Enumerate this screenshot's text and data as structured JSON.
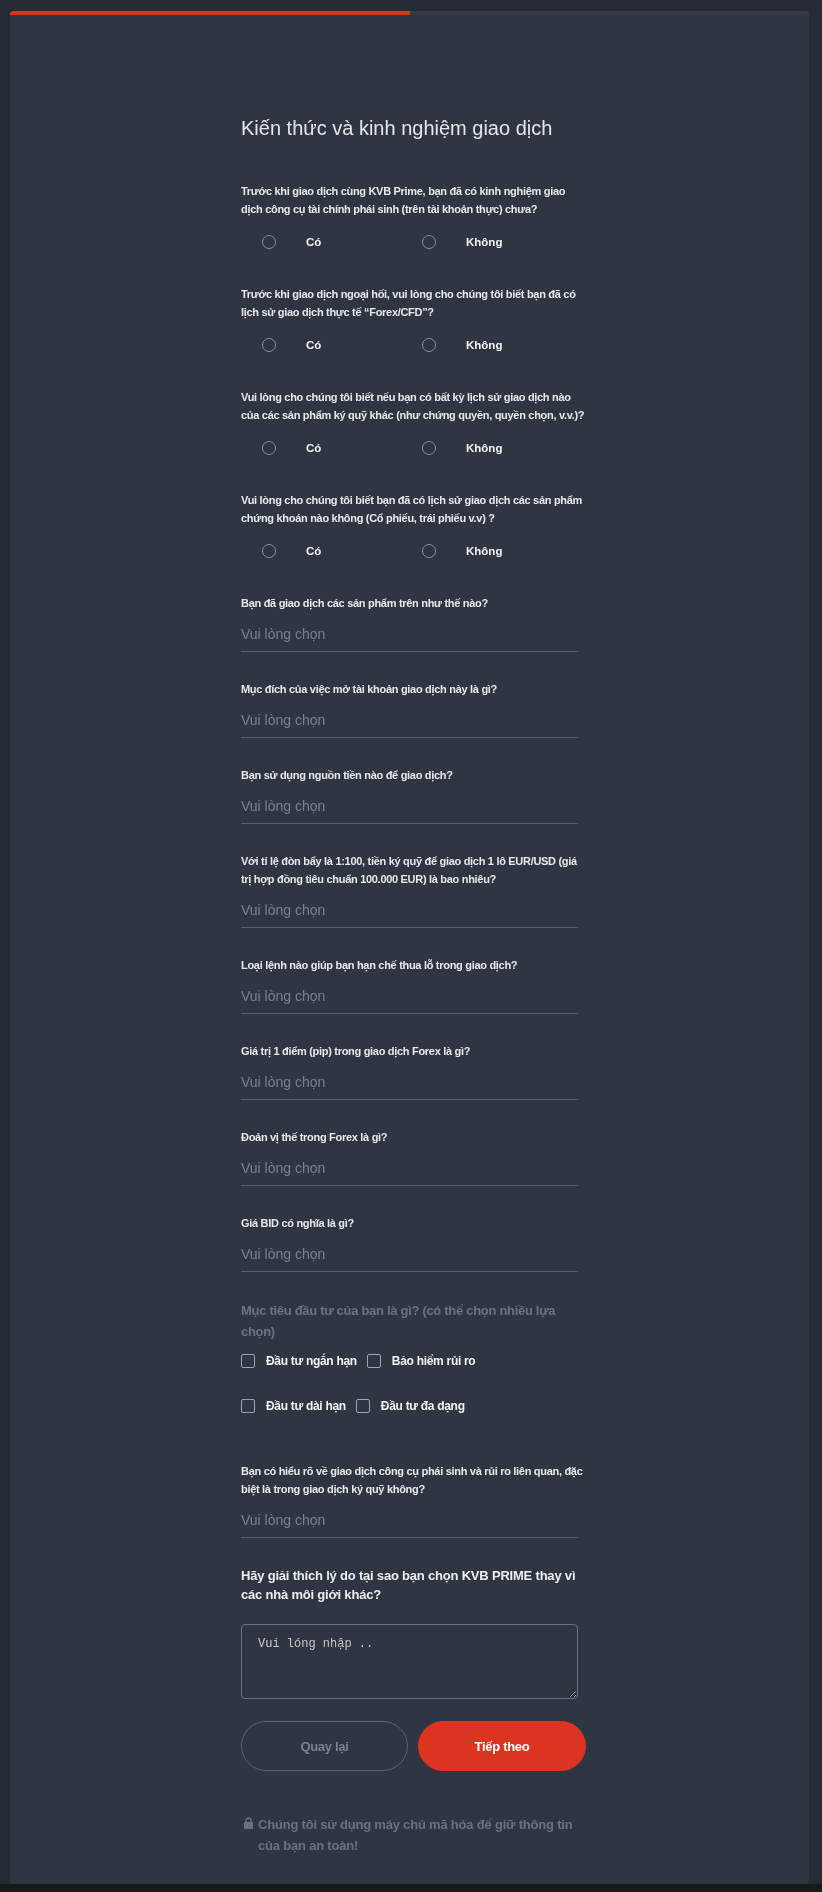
{
  "progress": {
    "level": 0.5
  },
  "title": "Kiến thức và kinh nghiệm giao dịch",
  "questions": [
    {
      "kind": "radio",
      "label": "Trước khi giao dịch cùng KVB Prime, bạn đã có kinh nghiệm giao dịch công cụ tài chính phái sinh (trên tài khoản thực) chưa?",
      "options": [
        {
          "label": "Có",
          "selected": false
        },
        {
          "label": "Không",
          "selected": false
        }
      ]
    },
    {
      "kind": "radio",
      "label": "Trước khi giao dịch ngoại hối, vui lòng cho chúng tôi biết bạn đã có lịch sử giao dịch thực tế “Forex/CFD”?",
      "options": [
        {
          "label": "Có",
          "selected": false
        },
        {
          "label": "Không",
          "selected": false
        }
      ]
    },
    {
      "kind": "radio",
      "label": "Vui lòng cho chúng tôi biết nếu bạn có bất kỳ lịch sử giao dịch nào của các sản phẩm ký quỹ khác (như chứng quyền, quyền chọn, v.v.)?",
      "options": [
        {
          "label": "Có",
          "selected": false
        },
        {
          "label": "Không",
          "selected": false
        }
      ]
    },
    {
      "kind": "radio",
      "label": "Vui lòng cho chúng tôi biết bạn đã có lịch sử giao dịch các sản phẩm chứng khoán nào không (Cổ phiếu, trái phiếu v.v) ?",
      "options": [
        {
          "label": "Có",
          "selected": false
        },
        {
          "label": "Không",
          "selected": false
        }
      ]
    },
    {
      "kind": "select",
      "label": "Bạn đã giao dịch các sản phẩm trên như thế nào?",
      "placeholder": "Vui lòng chọn"
    },
    {
      "kind": "select",
      "label": "Mục đích của việc mở tài khoản giao dịch này là gì?",
      "placeholder": "Vui lòng chọn"
    },
    {
      "kind": "select",
      "label": "Bạn sử dụng nguồn tiền nào để giao dịch?",
      "placeholder": "Vui lòng chọn"
    },
    {
      "kind": "select",
      "label": "Với tỉ lệ đòn bẩy là 1:100, tiền ký quỹ để giao dịch 1 lô EUR/USD (giá trị hợp đồng tiêu chuẩn 100.000 EUR) là bao nhiêu?",
      "placeholder": "Vui lòng chọn"
    },
    {
      "kind": "select",
      "label": "Loại lệnh nào giúp bạn hạn chế thua lỗ trong giao dịch?",
      "placeholder": "Vui lòng chọn"
    },
    {
      "kind": "select",
      "label": "Giá trị 1 điểm (pip) trong giao dịch Forex là gì?",
      "placeholder": "Vui lòng chọn"
    },
    {
      "kind": "select",
      "label": "Đoản vị thế trong Forex là gì?",
      "placeholder": "Vui lòng chọn"
    },
    {
      "kind": "select",
      "label": "Giá BID có nghĩa là gì?",
      "placeholder": "Vui lòng chọn"
    },
    {
      "kind": "checkbox",
      "label": "Mục tiêu đầu tư của bạn là gì? (có thể chọn nhiều lựa chọn)",
      "options": [
        {
          "label": "Đầu tư ngắn hạn",
          "checked": false
        },
        {
          "label": "Bảo hiểm rủi ro",
          "checked": false
        },
        {
          "label": "Đầu tư dài hạn",
          "checked": false
        },
        {
          "label": "Đầu tư đa dạng",
          "checked": false
        }
      ]
    },
    {
      "kind": "select",
      "label": "Bạn có hiểu rõ về giao dịch công cụ phái sinh và rủi ro liên quan, đặc biệt là trong giao dịch ký quỹ không?",
      "placeholder": "Vui lòng chọn"
    },
    {
      "kind": "textarea",
      "label": "Hãy giải thích lý do tại sao bạn chọn KVB PRIME thay vì các nhà môi giới khác?",
      "placeholder": "Vui lóng nhập .."
    }
  ],
  "buttons": [
    {
      "kind": "secondary",
      "label": "Quay lại"
    },
    {
      "kind": "primary",
      "label": "Tiếp theo"
    }
  ],
  "security_note": "Chúng tôi sử dụng máy chủ mã hóa để giữ thông tin của bạn an toàn!"
}
